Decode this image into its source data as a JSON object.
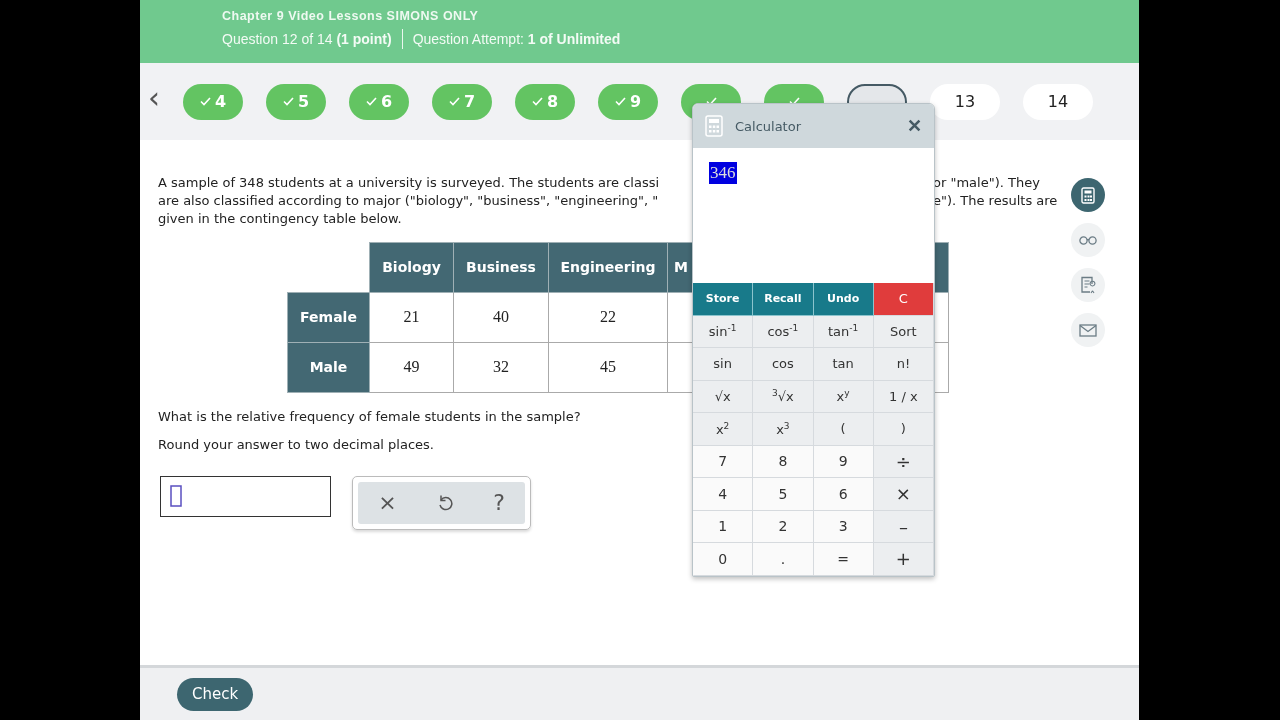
{
  "header": {
    "title": "Chapter 9 Video Lessons SIMONS ONLY",
    "question": "Question 12 of 14 **(1 point)**",
    "attempt": "Question Attempt: **1 of Unlimited**"
  },
  "nav": {
    "back": "‹",
    "questions": [
      {
        "label": "4",
        "done": true,
        "selected": false
      },
      {
        "label": "5",
        "done": true,
        "selected": false
      },
      {
        "label": "6",
        "done": true,
        "selected": false
      },
      {
        "label": "7",
        "done": true,
        "selected": false
      },
      {
        "label": "8",
        "done": true,
        "selected": false
      },
      {
        "label": "9",
        "done": true,
        "selected": false
      },
      {
        "done": true,
        "selected": false
      },
      {
        "done": true,
        "selected": false
      },
      {
        "done": false,
        "selected": true
      },
      {
        "label": "13",
        "done": false,
        "selected": false
      },
      {
        "label": "14",
        "done": false,
        "selected": false
      }
    ]
  },
  "intro": [
    {
      "left": "A sample of 348 students at a university is surveyed. The students are classi",
      "right": "or \"male\"). They"
    },
    {
      "left": "are also classified according to major (\"biology\", \"business\", \"engineering\", \"",
      "right": "e\"). The results are"
    },
    {
      "left": "given in the contingency table below."
    }
  ],
  "table": {
    "columns": [
      "Biology",
      "Business",
      "Engineering",
      "M"
    ],
    "rows": [
      {
        "label": "Female",
        "cells": [
          "21",
          "40",
          "22"
        ]
      },
      {
        "label": "Male",
        "cells": [
          "49",
          "32",
          "45"
        ]
      }
    ]
  },
  "question": "What is the relative frequency of female students in the sample?",
  "instruction": "Round your answer to two decimal places.",
  "answer_tools": [
    "×",
    "?"
  ],
  "sidebar": [
    {
      "kind": "calculator",
      "selected": true
    },
    {
      "kind": "glasses",
      "selected": false
    },
    {
      "kind": "notes",
      "selected": false
    },
    {
      "kind": "mail",
      "selected": false
    }
  ],
  "calculator": {
    "title": "Calculator",
    "close": "✕",
    "display": "346",
    "keys": [
      [
        {
          "label": "Store",
          "kind": "memory"
        },
        {
          "label": "Recall",
          "kind": "memory"
        },
        {
          "label": "Undo",
          "kind": "memory"
        },
        {
          "label": "C",
          "kind": "clear"
        }
      ],
      [
        {
          "label": "sin$^{-1}$",
          "kind": "func"
        },
        {
          "label": "cos$^{-1}$",
          "kind": "func"
        },
        {
          "label": "tan$^{-1}$",
          "kind": "func"
        },
        {
          "label": "Sort",
          "kind": "func"
        }
      ],
      [
        {
          "label": "sin",
          "kind": "func"
        },
        {
          "label": "cos",
          "kind": "func"
        },
        {
          "label": "tan",
          "kind": "func"
        },
        {
          "label": "n!",
          "kind": "func"
        }
      ],
      [
        {
          "label": "√x",
          "kind": "func"
        },
        {
          "label": "$^{3}$√x",
          "kind": "func"
        },
        {
          "label": "x$^{y}$",
          "kind": "func"
        },
        {
          "label": "1 / x",
          "kind": "func"
        }
      ],
      [
        {
          "label": "x$^{2}$",
          "kind": "func"
        },
        {
          "label": "x$^{3}$",
          "kind": "func"
        },
        {
          "label": "(",
          "kind": "func"
        },
        {
          "label": ")",
          "kind": "func"
        }
      ],
      [
        {
          "label": "7",
          "kind": "digit"
        },
        {
          "label": "8",
          "kind": "digit"
        },
        {
          "label": "9",
          "kind": "digit"
        },
        {
          "label": "÷",
          "kind": "op"
        }
      ],
      [
        {
          "label": "4",
          "kind": "digit"
        },
        {
          "label": "5",
          "kind": "digit"
        },
        {
          "label": "6",
          "kind": "digit"
        },
        {
          "label": "×",
          "kind": "op"
        }
      ],
      [
        {
          "label": "1",
          "kind": "digit"
        },
        {
          "label": "2",
          "kind": "digit"
        },
        {
          "label": "3",
          "kind": "digit"
        },
        {
          "label": "–",
          "kind": "op"
        }
      ],
      [
        {
          "label": "0",
          "kind": "digit"
        },
        {
          "label": ".",
          "kind": "digit"
        },
        {
          "label": "=",
          "kind": "digit"
        },
        {
          "label": "+",
          "kind": "op"
        }
      ]
    ]
  },
  "footer": {
    "check": "Check"
  }
}
